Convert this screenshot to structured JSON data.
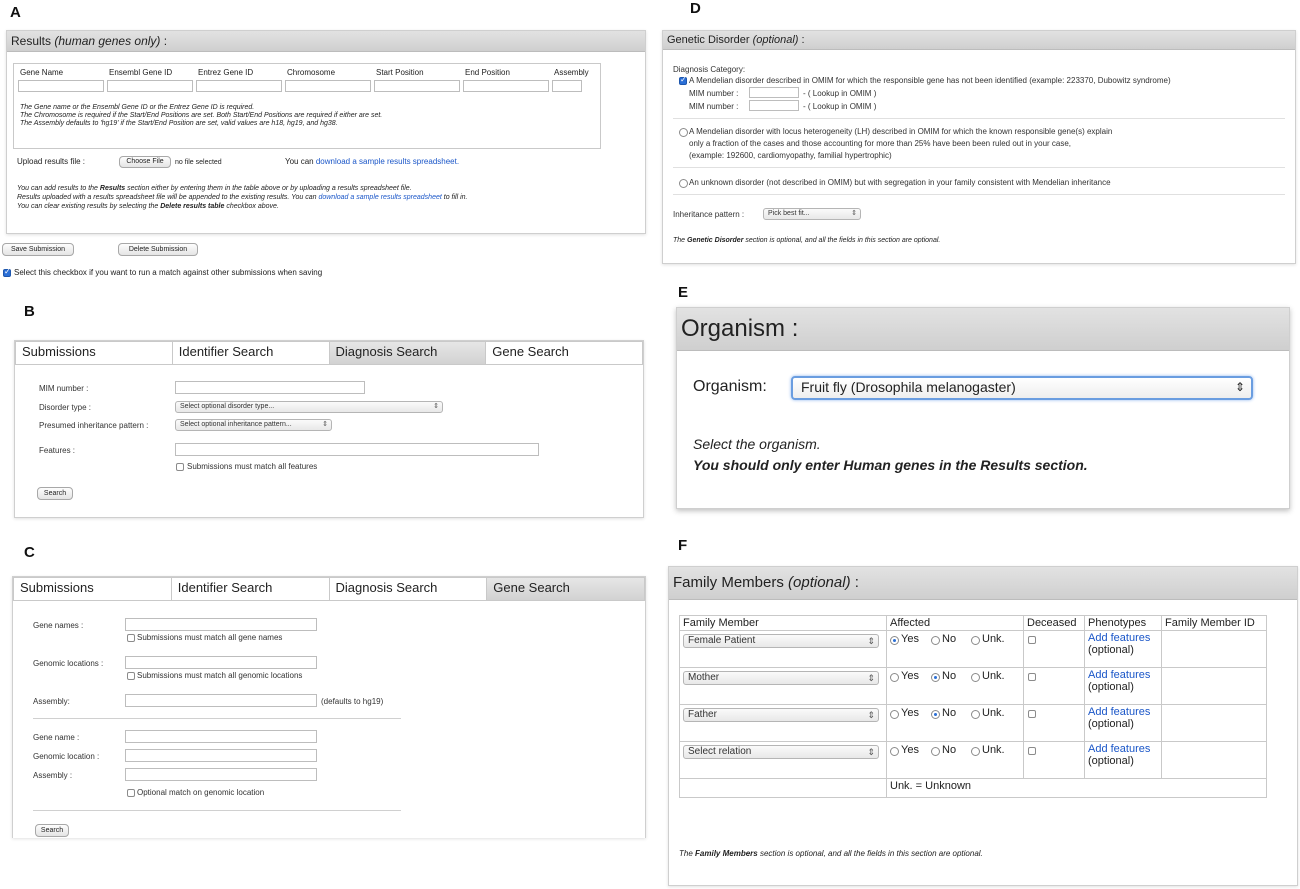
{
  "labels": {
    "a": "A",
    "b": "B",
    "c": "C",
    "d": "D",
    "e": "E",
    "f": "F"
  },
  "results": {
    "title_plain": "Results",
    "title_italic": "(human genes only)",
    "title_colon": " :",
    "columns": [
      "Gene Name",
      "Ensembl Gene ID",
      "Entrez Gene ID",
      "Chromosome",
      "Start Position",
      "End Position",
      "Assembly"
    ],
    "note1": "The Gene name or the Ensembl Gene ID or the Entrez Gene ID is required.",
    "note2": "The Chromosome is required if the Start/End Positions are set. Both Start/End Positions are required if either are set.",
    "note3": "The Assembly defaults to 'hg19' if the Start/End Position are set, valid values are h18, hg19, and hg38.",
    "upload_label": "Upload results file :",
    "choose_file": "Choose File",
    "no_file": "no file selected",
    "you_can": "You can",
    "download_link": "download a sample results spreadsheet.",
    "info1a": "You can add results to the",
    "info1b": "Results",
    "info1c": "section either by entering them in the table above or by uploading a results spreadsheet file.",
    "info2a": "Results uploaded with a results spreadsheet file will be appended to the existing results. You can",
    "info2b": "download a sample results spreadsheet",
    "info2c": "to fill in.",
    "info3a": "You can clear existing results by selecting the",
    "info3b": "Delete results table",
    "info3c": "checkbox above.",
    "save_btn": "Save Submission",
    "delete_btn": "Delete Submission",
    "match_checkbox": "Select this checkbox if you want to run a match against other submissions when saving"
  },
  "tabs": [
    "Submissions",
    "Identifier Search",
    "Diagnosis Search",
    "Gene Search"
  ],
  "diag": {
    "mim_label": "MIM number :",
    "disorder_label": "Disorder type :",
    "disorder_select": "Select optional disorder type...",
    "inheritance_label": "Presumed inheritance pattern :",
    "inheritance_select": "Select optional inheritance pattern...",
    "features_label": "Features :",
    "match_all": "Submissions must match all features",
    "search": "Search"
  },
  "gene": {
    "gene_names_label": "Gene names :",
    "match_gene_names": "Submissions must match all gene names",
    "genomic_label": "Genomic locations :",
    "match_genomic": "Submissions must match all genomic locations",
    "assembly_label": "Assembly:",
    "assembly_default": "(defaults to hg19)",
    "gene_name_label": "Gene name :",
    "genomic_location_label": "Genomic location :",
    "assembly_label2": "Assembly :",
    "optional_match": "Optional match on genomic location",
    "search": "Search"
  },
  "genetic": {
    "title_plain": "Genetic Disorder",
    "title_italic": "(optional)",
    "title_colon": " :",
    "category_label": "Diagnosis Category:",
    "opt1": "A Mendelian disorder described in OMIM for which the responsible gene has not been identified (example: 223370, Dubowitz syndrome)",
    "mim_label": "MIM number :",
    "lookup": "- ( Lookup in OMIM )",
    "opt2_l1": "A Mendelian disorder with locus heterogeneity (LH) described in OMIM for which the known responsible gene(s) explain",
    "opt2_l2": "only a fraction of the cases and those accounting for more than 25% have been been ruled out in your case,",
    "opt2_l3": "(example: 192600, cardiomyopathy, familial hypertrophic)",
    "opt3": "An unknown disorder (not described in OMIM) but with segregation in your family consistent with Mendelian inheritance",
    "inheritance_label": "Inheritance pattern :",
    "inheritance_select": "Pick best fit...",
    "foot_a": "The",
    "foot_b": "Genetic Disorder",
    "foot_c": "section is optional, and all the fields in this section are optional."
  },
  "organism": {
    "title": "Organism :",
    "label": "Organism:",
    "selected": "Fruit fly (Drosophila melanogaster)",
    "help1": "Select the organism.",
    "help2": "You should only enter Human genes in the Results section."
  },
  "family": {
    "title_plain": "Family Members",
    "title_italic": "(optional)",
    "title_colon": " :",
    "headers": [
      "Family Member",
      "Affected",
      "Deceased",
      "Phenotypes",
      "Family Member ID"
    ],
    "yes": "Yes",
    "no": "No",
    "unk": "Unk.",
    "add_features": "Add features",
    "optional": "(optional)",
    "rows": [
      {
        "member": "Female Patient",
        "affected": "yes"
      },
      {
        "member": "Mother",
        "affected": "no"
      },
      {
        "member": "Father",
        "affected": "no"
      },
      {
        "member": "Select relation",
        "affected": "none"
      }
    ],
    "legend": "Unk. = Unknown",
    "foot_a": "The",
    "foot_b": "Family Members",
    "foot_c": "section is optional, and all the fields in this section are optional."
  },
  "colors": {
    "link": "#1a56c8",
    "check": "#2b6fd6",
    "header": "#d6d6d6"
  }
}
